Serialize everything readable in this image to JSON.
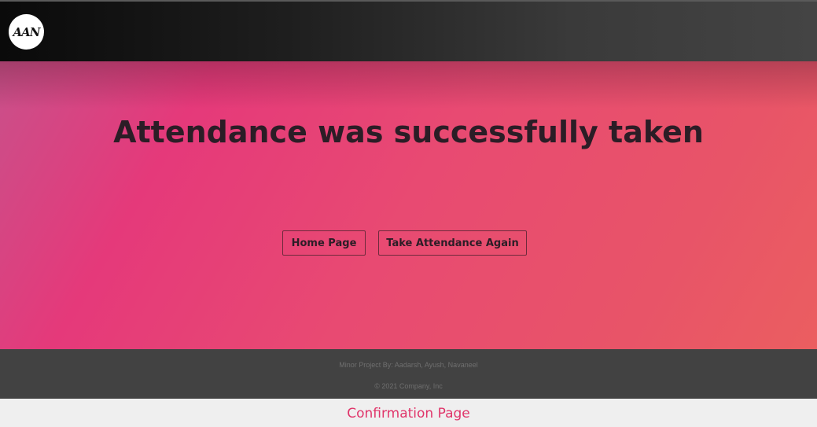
{
  "navbar": {
    "logo_text": "AAN"
  },
  "hero": {
    "title": "Attendance was successfully taken",
    "buttons": {
      "home_label": "Home Page",
      "again_label": "Take Attendance Again"
    }
  },
  "footer": {
    "credits": "Minor Project By: Aadarsh, Ayush, Navaneel",
    "copyright": "© 2021 Company, Inc"
  },
  "caption": "Confirmation Page",
  "colors": {
    "accent": "#e0356a",
    "navbar": "#1e1e1e",
    "footer": "#424242"
  }
}
